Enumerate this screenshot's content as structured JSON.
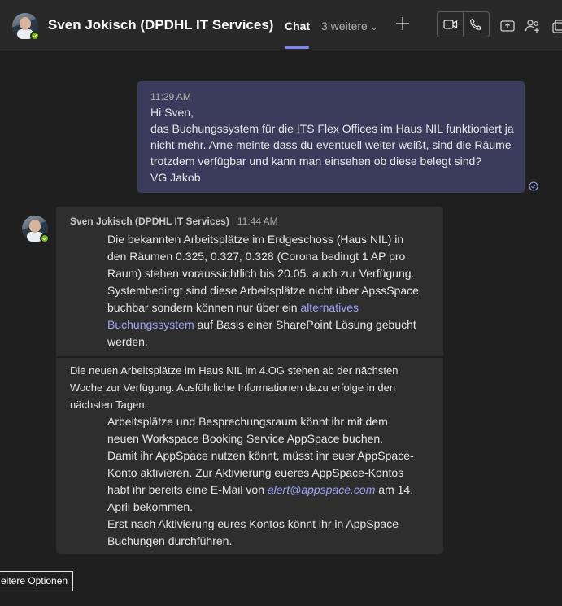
{
  "header": {
    "contact_name": "Sven Jokisch (DPDHL IT Services)",
    "tab_chat": "Chat",
    "tab_more": "3 weitere",
    "icons": [
      "video-call-icon",
      "audio-call-icon",
      "share-screen-icon",
      "add-people-icon",
      "popout-icon"
    ]
  },
  "messages": {
    "sent": {
      "time": "11:29 AM",
      "lines": [
        "Hi Sven,",
        "das Buchungssystem für die ITS Flex Offices im Haus NIL funktioniert ja",
        "nicht mehr. Arne meinte dass du eventuell weiter weißt, sind die Räume",
        "trotzdem verfügbar und kann man einsehen ob diese belegt sind?",
        "VG Jakob"
      ]
    },
    "received": {
      "sender": "Sven Jokisch (DPDHL IT Services)",
      "time": "11:44 AM",
      "part1": {
        "l1": "Die bekannten Arbeitsplätze im Erdgeschoss (Haus NIL) in",
        "l2": "den Räumen 0.325, 0.327, 0.328 (Corona bedingt 1 AP pro",
        "l3": "Raum) stehen voraussichtlich bis 20.05. auch zur Verfügung.",
        "l4": "Systembedingt sind diese Arbeitsplätze nicht über ApssSpace",
        "l5_pre": "buchbar sondern können nur über ein ",
        "l5_link": "alternatives",
        "l6_link": "Buchungssystem",
        "l6_post": " auf Basis einer SharePoint Lösung gebucht",
        "l7": "werden."
      },
      "part2": {
        "intro": [
          "Die neuen Arbeitsplätze im Haus NIL im 4.OG stehen ab der nächsten",
          "Woche zur Verfügung. Ausführliche Informationen dazu erfolge in den",
          "nächsten Tagen."
        ],
        "l1": "Arbeitsplätze und Besprechungsraum könnt ihr mit dem",
        "l2": "neuen Workspace Booking Service AppSpace buchen.",
        "l3": "Damit ihr AppSpace nutzen könnt, müsst ihr euer AppSpace-",
        "l4": "Konto aktivieren. Zur Aktivierung eueres AppSpace-Kontos",
        "l5_pre": "habt ihr bereits eine E-Mail von ",
        "l5_link": "alert@appspace.com",
        "l5_post": " am 14.",
        "l6": "April bekommen.",
        "l7": "Erst nach Aktivierung eures Kontos könnt ihr in AppSpace",
        "l8": "Buchungen durchführen."
      }
    }
  },
  "more_options": "eitere Optionen",
  "colors": {
    "background": "#1f1f1f",
    "header": "#292929",
    "sent_bubble": "#3b3c5c",
    "received_bubble": "#2e2e2e",
    "accent": "#7f85f5",
    "link": "#9da3f5",
    "presence": "#6bb700"
  }
}
